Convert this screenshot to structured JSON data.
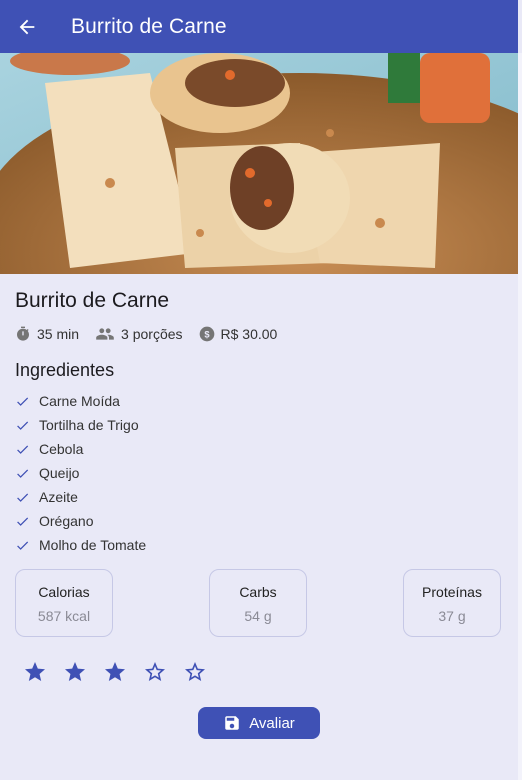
{
  "appbar": {
    "title": "Burrito de Carne",
    "back_icon": "arrow-back-icon"
  },
  "recipe": {
    "name": "Burrito de Carne",
    "time": "35 min",
    "servings": "3 porções",
    "price": "R$ 30.00"
  },
  "ingredients_title": "Ingredientes",
  "ingredients": [
    "Carne Moída",
    "Tortilha de Trigo",
    "Cebola",
    "Queijo",
    "Azeite",
    "Orégano",
    "Molho de Tomate"
  ],
  "nutrition": [
    {
      "label": "Calorias",
      "value": "587 kcal"
    },
    {
      "label": "Carbs",
      "value": "54 g"
    },
    {
      "label": "Proteínas",
      "value": "37 g"
    }
  ],
  "rating": {
    "value": 3,
    "max": 5
  },
  "rate_button": {
    "label": "Avaliar",
    "icon": "save-icon"
  },
  "colors": {
    "primary": "#3f51b5",
    "background": "#e9e9f7"
  }
}
